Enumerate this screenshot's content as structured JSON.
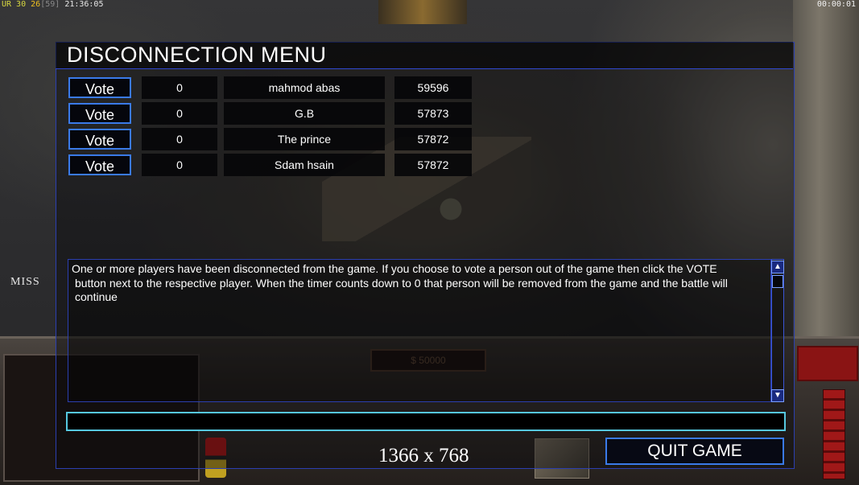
{
  "hud": {
    "fps_prefix": "UR 30",
    "fps_value": "26",
    "fps_bracket": "[59]",
    "clock_left": "21:36:05",
    "clock_right": "00:00:01",
    "money": "$ 50000",
    "miss_label": "MISS"
  },
  "dialog": {
    "title": "DISCONNECTION MENU",
    "players": [
      {
        "vote_label": "Vote",
        "votes": "0",
        "name": "mahmod abas",
        "timer": "59596"
      },
      {
        "vote_label": "Vote",
        "votes": "0",
        "name": "G.B",
        "timer": "57873"
      },
      {
        "vote_label": "Vote",
        "votes": "0",
        "name": "The prince",
        "timer": "57872"
      },
      {
        "vote_label": "Vote",
        "votes": "0",
        "name": "Sdam hsain",
        "timer": "57872"
      }
    ],
    "message_line1": "One or more players have been disconnected from the game. If you choose to vote a person out of the game then click the VOTE",
    "message_line2": "button next to the respective player. When the timer counts down to 0 that person will be removed from the game and the battle will continue",
    "chat_value": "",
    "quit_label": "QUIT GAME"
  },
  "overlay": {
    "resolution": "1366 x 768"
  },
  "colors": {
    "border_blue": "#3a7ae8",
    "frame_blue": "#2b3fb0",
    "input_cyan": "#56c8e0"
  }
}
